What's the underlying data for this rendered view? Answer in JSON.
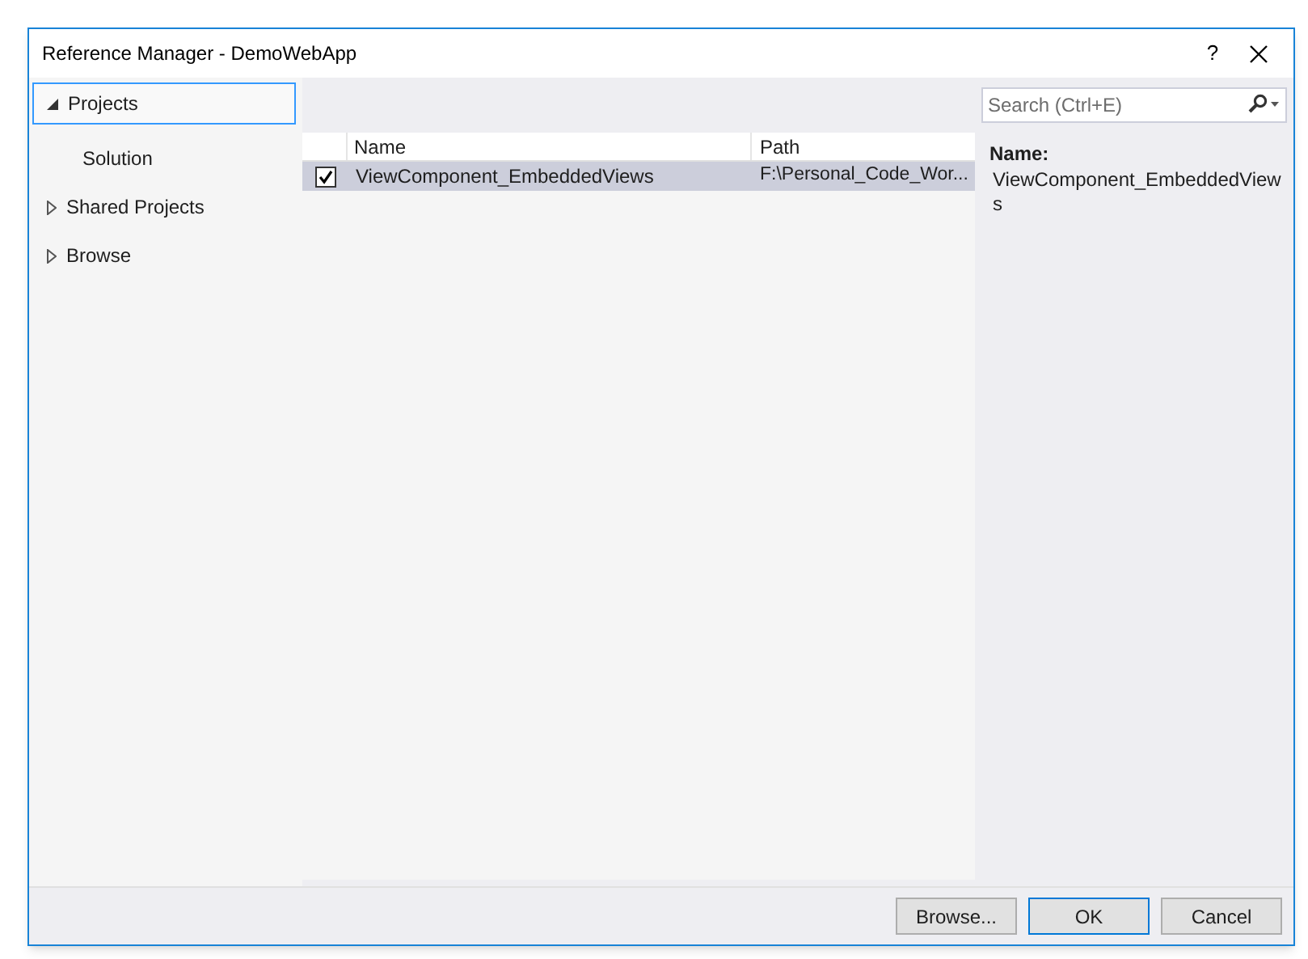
{
  "window": {
    "title": "Reference Manager - DemoWebApp",
    "buttons": [
      {
        "kind": "help",
        "label": "?"
      }
    ]
  },
  "sidebar": {
    "items": [
      {
        "label": "Projects",
        "expanded": true,
        "selected": true,
        "children": [
          {
            "label": "Solution",
            "selected": false
          }
        ]
      },
      {
        "label": "Shared Projects",
        "expanded": false,
        "selected": false
      },
      {
        "label": "Browse",
        "expanded": false,
        "selected": false
      }
    ]
  },
  "search": {
    "placeholder": "Search (Ctrl+E)"
  },
  "table": {
    "columns": [
      "Name",
      "Path"
    ],
    "rows": [
      {
        "checked": true,
        "selected": true,
        "cells": [
          "ViewComponent_EmbeddedViews",
          "F:\\Personal_Code_Wor..."
        ]
      }
    ]
  },
  "details": {
    "label": "Name:",
    "value": "ViewComponent_EmbeddedViews"
  },
  "buttons": [
    {
      "label": "Browse...",
      "default": false
    },
    {
      "label": "OK",
      "default": true
    },
    {
      "label": "Cancel",
      "default": false
    }
  ]
}
